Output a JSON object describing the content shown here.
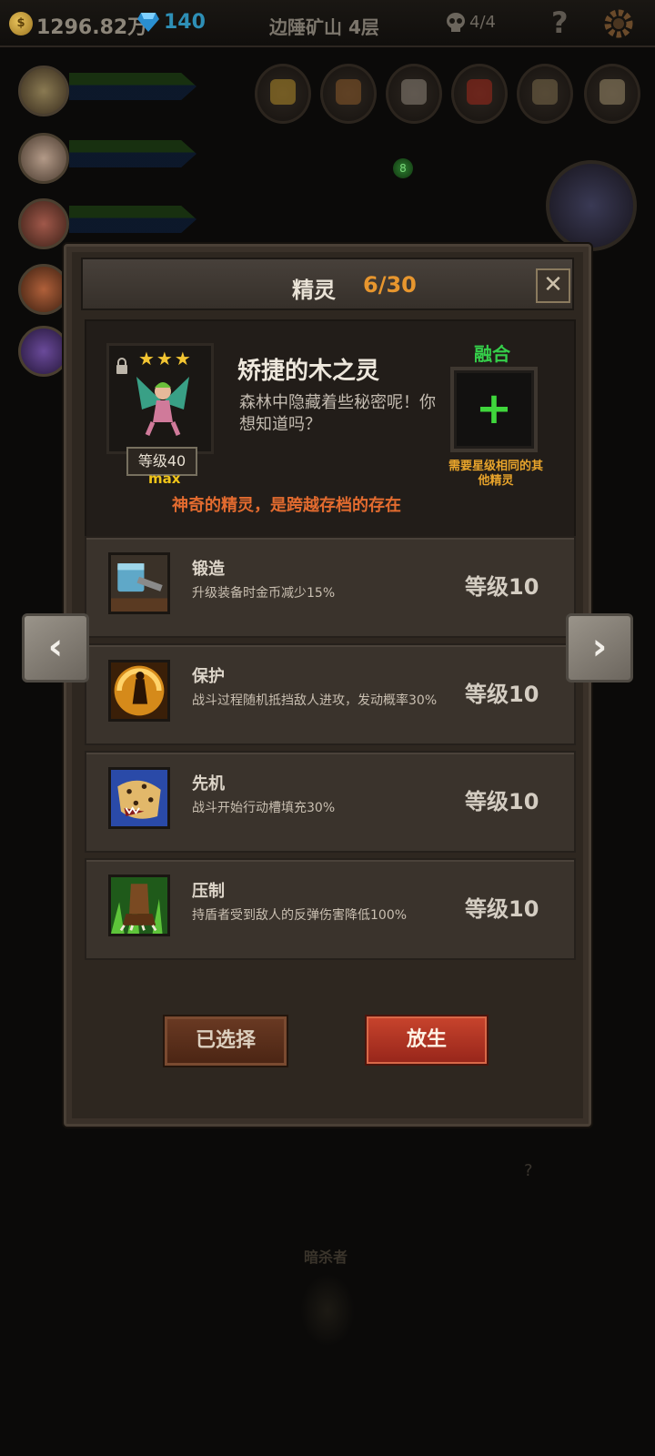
{
  "topbar": {
    "gold": "1296.82万",
    "gems": "140",
    "level_name": "边陲矿山 4层",
    "kills": "4/4",
    "help_label": "?",
    "coin_symbol": "$"
  },
  "scene": {
    "green_orb": "8",
    "question_mark": "?",
    "assassin_label": "暗杀者",
    "equip_icons": [
      "feather-icon",
      "pouch-icon",
      "eagle-icon",
      "axe-icon",
      "flute-icon",
      "bell-icon"
    ]
  },
  "modal": {
    "title": "精灵",
    "count": "6/30",
    "close_label": "✕",
    "spirit": {
      "name": "矫捷的木之灵",
      "description": "森林中隐藏着些秘密呢！你想知道吗？",
      "stars": "★★★",
      "level_badge": "等级40",
      "max_label": "max",
      "tagline": "神奇的精灵，是跨越存档的存在"
    },
    "fuse": {
      "title": "融合",
      "plus": "+",
      "note": "需要星级相同的其他精灵"
    },
    "skills": [
      {
        "name": "锻造",
        "description": "升级装备时金币减少15%",
        "level": "等级10",
        "icon": "hammer-icon"
      },
      {
        "name": "保护",
        "description": "战斗过程随机抵挡敌人进攻，发动概率30%",
        "level": "等级10",
        "icon": "shield-aura-icon"
      },
      {
        "name": "先机",
        "description": "战斗开始行动槽填充30%",
        "level": "等级10",
        "icon": "leopard-icon"
      },
      {
        "name": "压制",
        "description": "持盾者受到敌人的反弹伤害降低100%",
        "level": "等级10",
        "icon": "beast-claw-icon"
      }
    ],
    "buttons": {
      "selected": "已选择",
      "release": "放生"
    },
    "nav": {
      "prev": "‹",
      "next": "›"
    }
  },
  "colors": {
    "accent_orange": "#e7962e",
    "fuse_green": "#35cf4a",
    "tagline_orange": "#e36b2f",
    "release_red": "#c8442d"
  }
}
